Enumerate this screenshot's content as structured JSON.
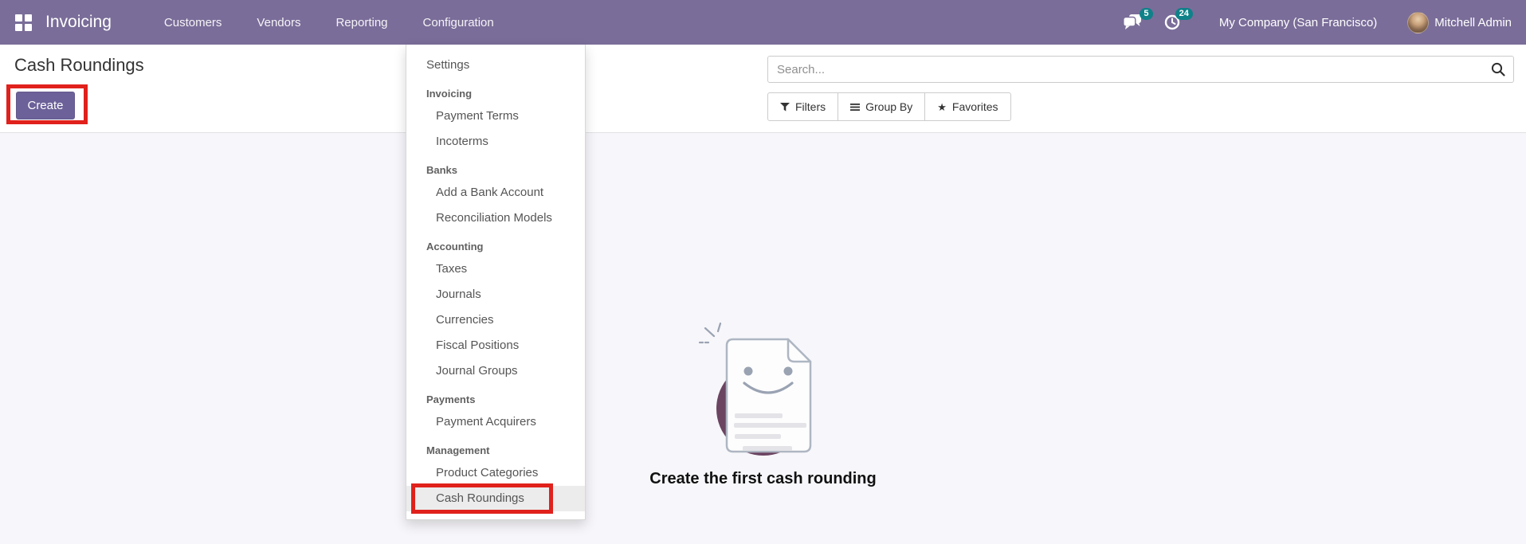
{
  "navbar": {
    "brand": "Invoicing",
    "links": [
      {
        "label": "Customers"
      },
      {
        "label": "Vendors"
      },
      {
        "label": "Reporting"
      },
      {
        "label": "Configuration"
      }
    ],
    "messages_count": "5",
    "activities_count": "24",
    "company": "My Company (San Francisco)",
    "user_name": "Mitchell Admin"
  },
  "control_panel": {
    "title": "Cash Roundings",
    "create_button": "Create",
    "search_placeholder": "Search...",
    "filters_label": "Filters",
    "group_by_label": "Group By",
    "favorites_label": "Favorites"
  },
  "config_menu": {
    "sections": [
      {
        "items": [
          {
            "label": "Settings"
          }
        ]
      },
      {
        "header": "Invoicing",
        "items": [
          {
            "label": "Payment Terms"
          },
          {
            "label": "Incoterms"
          }
        ]
      },
      {
        "header": "Banks",
        "items": [
          {
            "label": "Add a Bank Account"
          },
          {
            "label": "Reconciliation Models"
          }
        ]
      },
      {
        "header": "Accounting",
        "items": [
          {
            "label": "Taxes"
          },
          {
            "label": "Journals"
          },
          {
            "label": "Currencies"
          },
          {
            "label": "Fiscal Positions"
          },
          {
            "label": "Journal Groups"
          }
        ]
      },
      {
        "header": "Payments",
        "items": [
          {
            "label": "Payment Acquirers"
          }
        ]
      },
      {
        "header": "Management",
        "items": [
          {
            "label": "Product Categories"
          },
          {
            "label": "Cash Roundings"
          }
        ]
      }
    ]
  },
  "empty_state": {
    "caption": "Create the first cash rounding"
  },
  "colors": {
    "navbar_bg": "#7a6d99",
    "primary_button": "#6c6198",
    "badge_teal": "#0f8189",
    "annotation_red": "#e0211c",
    "illustration_circle": "#6b4462",
    "content_bg": "#f7f6fa"
  }
}
